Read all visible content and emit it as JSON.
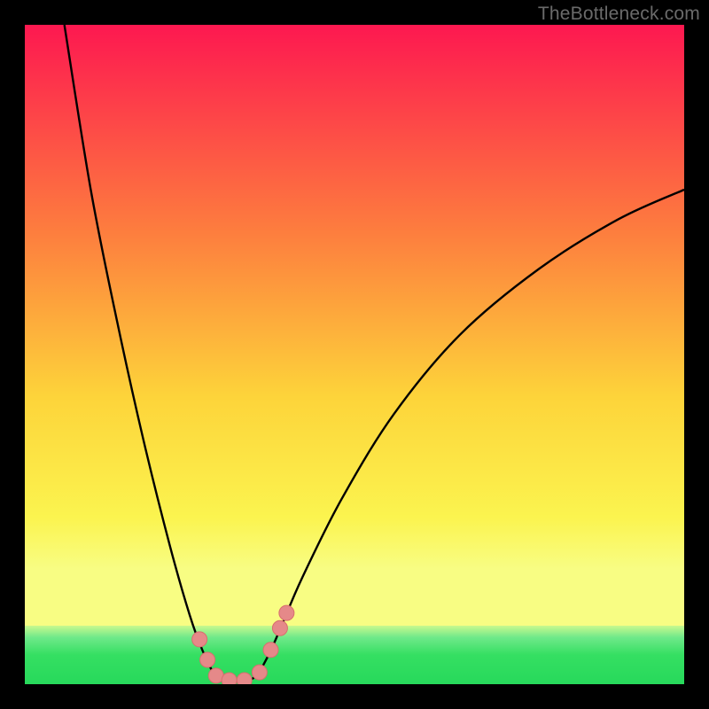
{
  "watermark": {
    "text": "TheBottleneck.com"
  },
  "colors": {
    "bg_black": "#000000",
    "curve": "#000000",
    "marker_fill": "#e58989",
    "marker_stroke": "#d86e6e",
    "band_green": "#35df62",
    "band_green_edge": "#6fe98a",
    "gradient_top": "#fd1850",
    "gradient_q1": "#fd7f3e",
    "gradient_mid": "#fdd43a",
    "gradient_q3": "#fbf44f",
    "gradient_low": "#f8fd83"
  },
  "chart_data": {
    "type": "line",
    "title": "",
    "xlabel": "",
    "ylabel": "",
    "xlim": [
      0,
      100
    ],
    "ylim": [
      0,
      100
    ],
    "note": "V-shaped bottleneck curve over a red→yellow→green vertical heat gradient. No axis ticks visible. Values are read off as percentage of plot width/height.",
    "green_band": {
      "y_start": 91.0,
      "y_end": 100.0
    },
    "series": [
      {
        "name": "bottleneck-curve",
        "points": [
          {
            "x": 6.0,
            "y": 100.0
          },
          {
            "x": 10.0,
            "y": 75.0
          },
          {
            "x": 14.0,
            "y": 55.0
          },
          {
            "x": 18.0,
            "y": 37.0
          },
          {
            "x": 22.0,
            "y": 21.0
          },
          {
            "x": 25.0,
            "y": 10.5
          },
          {
            "x": 27.0,
            "y": 5.0
          },
          {
            "x": 29.0,
            "y": 1.2
          },
          {
            "x": 31.0,
            "y": 0.5
          },
          {
            "x": 33.0,
            "y": 0.5
          },
          {
            "x": 35.0,
            "y": 1.2
          },
          {
            "x": 37.0,
            "y": 4.5
          },
          {
            "x": 39.0,
            "y": 9.0
          },
          {
            "x": 42.0,
            "y": 16.0
          },
          {
            "x": 48.0,
            "y": 28.0
          },
          {
            "x": 56.0,
            "y": 41.0
          },
          {
            "x": 66.0,
            "y": 53.0
          },
          {
            "x": 78.0,
            "y": 63.0
          },
          {
            "x": 90.0,
            "y": 70.5
          },
          {
            "x": 100.0,
            "y": 75.0
          }
        ]
      }
    ],
    "markers": [
      {
        "x": 26.5,
        "y": 6.8
      },
      {
        "x": 27.7,
        "y": 3.7
      },
      {
        "x": 29.0,
        "y": 1.3
      },
      {
        "x": 31.0,
        "y": 0.6
      },
      {
        "x": 33.3,
        "y": 0.6
      },
      {
        "x": 35.6,
        "y": 1.8
      },
      {
        "x": 37.3,
        "y": 5.2
      },
      {
        "x": 38.7,
        "y": 8.5
      },
      {
        "x": 39.7,
        "y": 10.8
      }
    ]
  }
}
